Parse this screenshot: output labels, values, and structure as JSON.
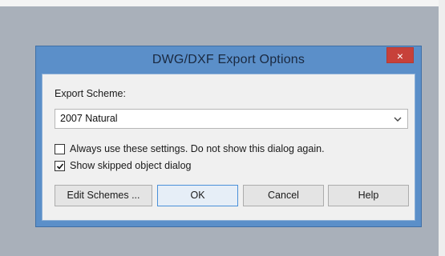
{
  "dialog": {
    "title": "DWG/DXF Export Options",
    "close_label": "×"
  },
  "export_scheme": {
    "label": "Export Scheme:",
    "selected": "2007 Natural"
  },
  "options": {
    "always_use": {
      "label": "Always use these settings. Do not show this dialog again.",
      "checked": false
    },
    "show_skipped": {
      "label": "Show skipped object dialog",
      "checked": true
    }
  },
  "buttons": {
    "edit_schemes": "Edit Schemes ...",
    "ok": "OK",
    "cancel": "Cancel",
    "help": "Help"
  },
  "colors": {
    "title_bar": "#5b8fc9",
    "close_button": "#c7413a",
    "client_bg": "#f0f0f0",
    "default_button_border": "#4a90d9"
  }
}
